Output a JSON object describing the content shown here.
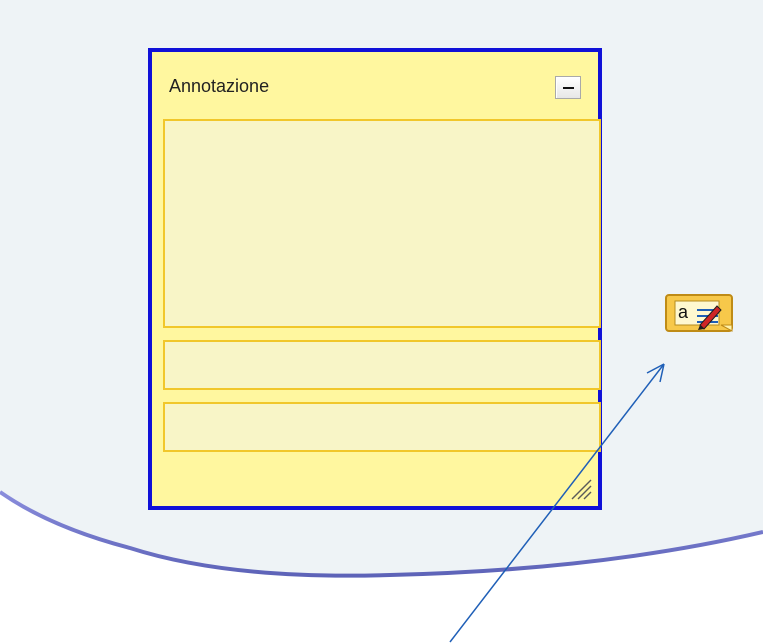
{
  "annotation": {
    "title": "Annotazione",
    "minimize_label": "",
    "body_text": "",
    "line_1_text": "",
    "line_2_text": ""
  },
  "icons": {
    "minimize": "minimize-icon",
    "resize_grip": "resize-grip-icon",
    "annotation_note": "annotation-note-icon",
    "note_letter": "a"
  },
  "colors": {
    "panel_border": "#1010d8",
    "panel_fill": "#fff79f",
    "field_border": "#f1c72b",
    "field_fill": "#f8f5c7",
    "canvas_fill": "#eef3f6",
    "arrow": "#1f5fb7"
  }
}
